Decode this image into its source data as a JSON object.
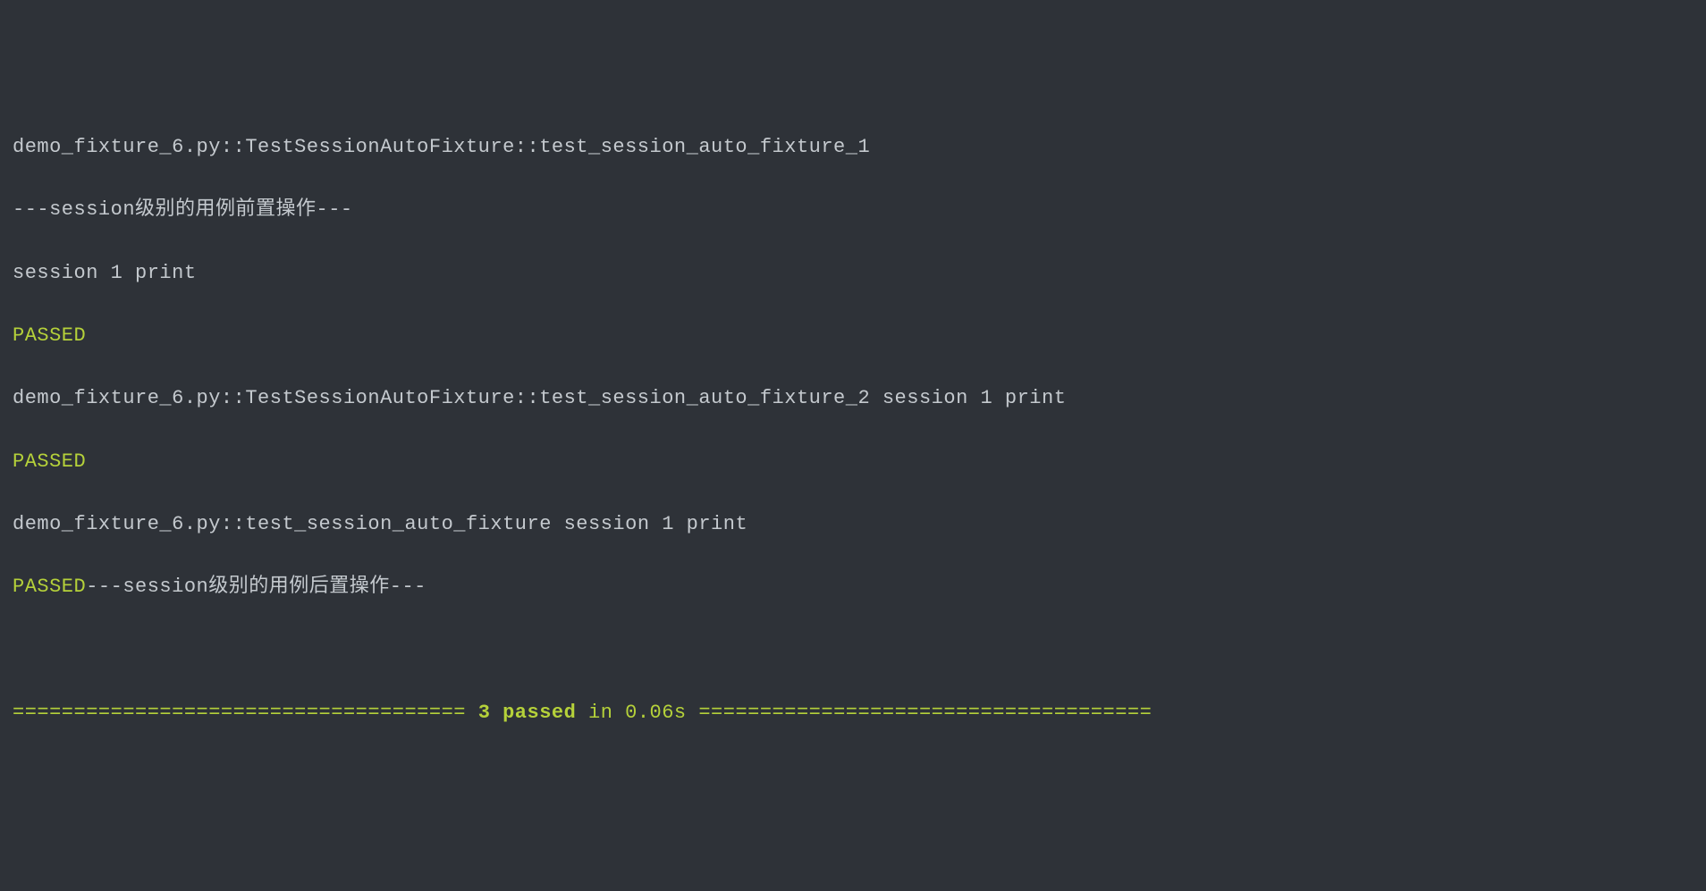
{
  "lines": {
    "l1": "demo_fixture_6.py::TestSessionAutoFixture::test_session_auto_fixture_1",
    "l2": "---session级别的用例前置操作---",
    "l3": "session 1 print",
    "l4": "PASSED",
    "l5a": "demo_fixture_6.py::TestSessionAutoFixture::test_session_auto_fixture_2 ",
    "l5b": "session 1 print",
    "l6": "PASSED",
    "l7a": "demo_fixture_6.py::test_session_auto_fixture ",
    "l7b": "session 1 print",
    "l8a": "PASSED",
    "l8b": "---session级别的用例后置操作---",
    "blank": ""
  },
  "summary": {
    "sep_left": "===================================== ",
    "passed": "3 passed",
    "timing": " in 0.06s",
    "sep_right": " ====================================="
  }
}
